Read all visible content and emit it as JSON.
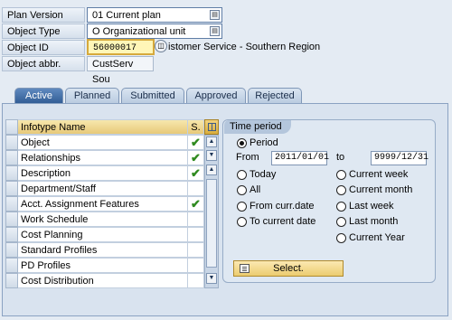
{
  "fields": {
    "plan_version": {
      "label": "Plan Version",
      "value": "01 Current plan"
    },
    "object_type": {
      "label": "Object Type",
      "value": "O Organizational unit"
    },
    "object_id": {
      "label": "Object ID",
      "value": "56000017",
      "description": "Customer Service - Southern Region",
      "description_visible": "istomer Service - Southern Region"
    },
    "object_abbr": {
      "label": "Object abbr.",
      "value": "CustServ Sou"
    }
  },
  "tabs": [
    {
      "label": "Active",
      "active": true
    },
    {
      "label": "Planned",
      "active": false
    },
    {
      "label": "Submitted",
      "active": false
    },
    {
      "label": "Approved",
      "active": false
    },
    {
      "label": "Rejected",
      "active": false
    }
  ],
  "infotype_table": {
    "col_name": "Infotype Name",
    "col_status": "S.",
    "rows": [
      {
        "name": "Object",
        "status": "✔"
      },
      {
        "name": "Relationships",
        "status": "✔"
      },
      {
        "name": "Description",
        "status": "✔"
      },
      {
        "name": "Department/Staff",
        "status": ""
      },
      {
        "name": "Acct. Assignment Features",
        "status": "✔"
      },
      {
        "name": "Work Schedule",
        "status": ""
      },
      {
        "name": "Cost Planning",
        "status": ""
      },
      {
        "name": "Standard Profiles",
        "status": ""
      },
      {
        "name": "PD Profiles",
        "status": ""
      },
      {
        "name": "Cost Distribution",
        "status": ""
      }
    ]
  },
  "time_period": {
    "title": "Time period",
    "period_label": "Period",
    "from_label": "From",
    "from_value": "2011/01/01",
    "to_label": "to",
    "to_value": "9999/12/31",
    "options_left": [
      "Today",
      "All",
      "From curr.date",
      "To current date"
    ],
    "options_right": [
      "Current week",
      "Current month",
      "Last week",
      "Last month",
      "Current Year"
    ],
    "select_button": "Select."
  },
  "colors": {
    "accent": "#2f5b93",
    "focus": "#fff6b8",
    "header": "#e7c979",
    "check": "#2f8a1f"
  }
}
